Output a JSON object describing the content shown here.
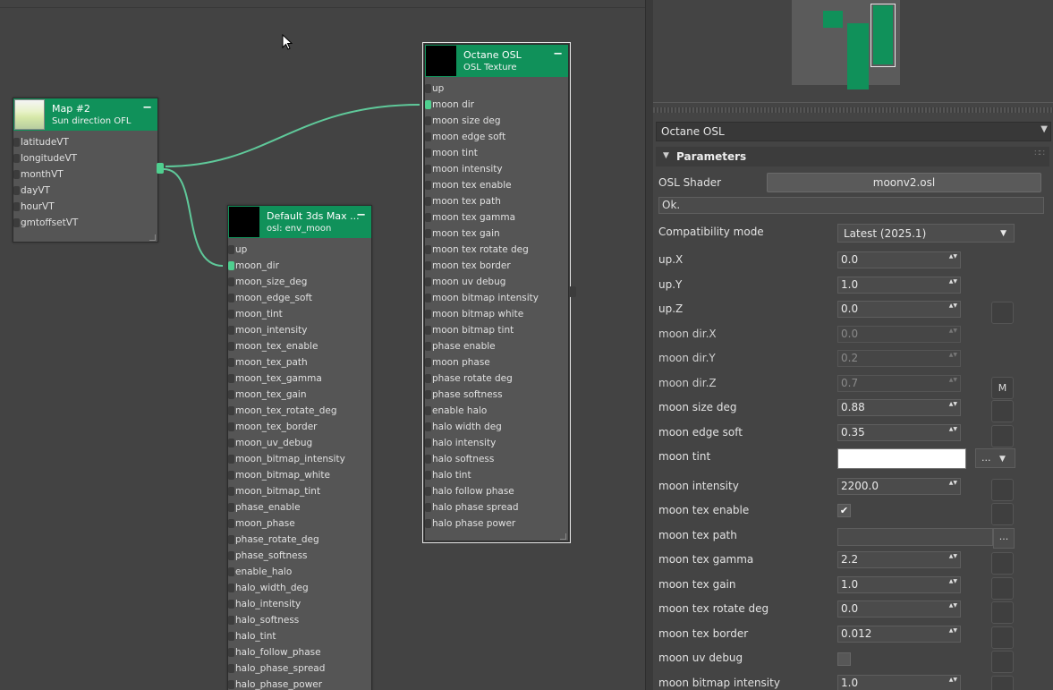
{
  "nodes": {
    "map2": {
      "title": "Map #2",
      "subtitle": "Sun direction OFL",
      "minimize": "−",
      "ports": [
        "latitudeVT",
        "longitudeVT",
        "monthVT",
        "dayVT",
        "hourVT",
        "gmtoffsetVT"
      ]
    },
    "default3ds": {
      "title": "Default 3ds Max ...",
      "subtitle": "osl: env_moon",
      "minimize": "−",
      "ports": [
        "up",
        "moon_dir",
        "moon_size_deg",
        "moon_edge_soft",
        "moon_tint",
        "moon_intensity",
        "moon_tex_enable",
        "moon_tex_path",
        "moon_tex_gamma",
        "moon_tex_gain",
        "moon_tex_rotate_deg",
        "moon_tex_border",
        "moon_uv_debug",
        "moon_bitmap_intensity",
        "moon_bitmap_white",
        "moon_bitmap_tint",
        "phase_enable",
        "moon_phase",
        "phase_rotate_deg",
        "phase_softness",
        "enable_halo",
        "halo_width_deg",
        "halo_intensity",
        "halo_softness",
        "halo_tint",
        "halo_follow_phase",
        "halo_phase_spread",
        "halo_phase_power"
      ]
    },
    "octaneosl": {
      "title": "Octane OSL",
      "subtitle": "OSL Texture",
      "minimize": "−",
      "ports": [
        "up",
        "moon dir",
        "moon size deg",
        "moon edge soft",
        "moon tint",
        "moon intensity",
        "moon tex enable",
        "moon tex path",
        "moon tex gamma",
        "moon tex gain",
        "moon tex rotate deg",
        "moon tex border",
        "moon uv debug",
        "moon bitmap intensity",
        "moon bitmap white",
        "moon bitmap tint",
        "phase enable",
        "moon phase",
        "phase rotate deg",
        "phase softness",
        "enable halo",
        "halo width deg",
        "halo intensity",
        "halo softness",
        "halo tint",
        "halo follow phase",
        "halo phase spread",
        "halo phase power"
      ]
    }
  },
  "panel": {
    "rollout_title": "Octane OSL",
    "rollout_arrow": "▼",
    "params_title": "Parameters",
    "params_arrow": "▼",
    "params_grip": "∷∷",
    "osl_shader_label": "OSL Shader",
    "osl_shader_file": "moonv2.osl",
    "status": "Ok.",
    "compat_label": "Compatibility mode",
    "compat_value": "Latest (2025.1)",
    "compat_arrow": "▼",
    "spin_arrows": "▲▼",
    "rows": {
      "upx": {
        "label": "up.X",
        "value": "0.0"
      },
      "upy": {
        "label": "up.Y",
        "value": "1.0"
      },
      "upz": {
        "label": "up.Z",
        "value": "0.0"
      },
      "mdx": {
        "label": "moon dir.X",
        "value": "0.0"
      },
      "mdy": {
        "label": "moon dir.Y",
        "value": "0.2"
      },
      "mdz": {
        "label": "moon dir.Z",
        "value": "0.7",
        "btn": "M"
      },
      "msize": {
        "label": "moon size deg",
        "value": "0.88"
      },
      "medge": {
        "label": "moon edge soft",
        "value": "0.35"
      },
      "mtint": {
        "label": "moon tint",
        "btn": "...",
        "arrow": "▼"
      },
      "mint": {
        "label": "moon intensity",
        "value": "2200.0"
      },
      "mtexen": {
        "label": "moon tex enable",
        "check": "✔"
      },
      "mtexpath": {
        "label": "moon tex path",
        "btn": "..."
      },
      "mtexgamma": {
        "label": "moon tex gamma",
        "value": "2.2"
      },
      "mtexgain": {
        "label": "moon tex gain",
        "value": "1.0"
      },
      "mtexrot": {
        "label": "moon tex rotate deg",
        "value": "0.0"
      },
      "mtexborder": {
        "label": "moon tex border",
        "value": "0.012"
      },
      "muvdebug": {
        "label": "moon uv debug"
      },
      "mbmpint": {
        "label": "moon bitmap intensity",
        "value": "1.0"
      }
    }
  },
  "colors": {
    "node_header": "#10915a",
    "pin_connected": "#4fcf8f",
    "wire": "#5fc99a"
  }
}
